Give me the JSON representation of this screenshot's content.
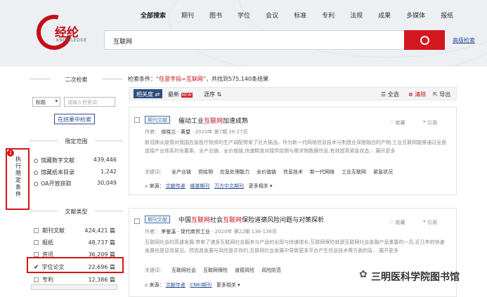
{
  "header": {
    "logo_text": "经纶",
    "logo_sub": "KNOWLEDGE",
    "nav": [
      "全部搜索",
      "期刊",
      "图书",
      "学位",
      "会议",
      "标准",
      "专利",
      "法规",
      "成果",
      "多媒体",
      "报纸"
    ],
    "search_value": "互联网",
    "advanced": "高级检索"
  },
  "sidebar": {
    "second_search_title": "二次检索",
    "field_select": "标题",
    "keyword_placeholder": "请输入检索词",
    "search_in_results": "在结果中检索",
    "scope_title": "限定范围",
    "scope": [
      {
        "label": "馆藏数字文献",
        "count": "439,446"
      },
      {
        "label": "馆藏纸本目录",
        "count": "1,242"
      },
      {
        "label": "OA开放获取",
        "count": "30,049"
      }
    ],
    "type_title": "文献类型",
    "types": [
      {
        "label": "期刊文献",
        "count": "424,421 篇"
      },
      {
        "label": "报纸",
        "count": "48,737 篇"
      },
      {
        "label": "资讯",
        "count": "36,209 篇"
      },
      {
        "label": "学位论文",
        "count": "22,696 篇"
      },
      {
        "label": "专利",
        "count": "12,386 篇"
      }
    ],
    "annotation_num": "1",
    "annotation_text": "执行限定条件"
  },
  "results": {
    "cond_prefix": "检索条件：",
    "cond_value": "“任意字段=互联网”",
    "cond_suffix": "，共找到575,140条结果",
    "sort": [
      "相关度 ⇄",
      "最新",
      "NEW",
      "涯序 ⇅"
    ],
    "actions": [
      "☰ 全选",
      "⊗ 清除",
      "⇱ 导出"
    ],
    "cards": [
      {
        "tag": "期刊文献",
        "title_pre": "催动工业",
        "title_hl": "互联网",
        "title_post": "加速成熟",
        "author_label": "作者：",
        "authors": "徐晓兰  · 黄望",
        "date": "· 2020年 第7期 26-27页",
        "abstract": "新冠肺炎疫情对我国应急医疗物资的生产调配带来了巨大挑战。作为新一代网络信息技术与制造业深度融合的产物,工业互联网能够通过全面连接产业体系的全要素、全产业链、全价值链,快速精准对接供给侧与需求侧数据信息,有效提高紧急状态... 展开更多",
        "kw_label": "关键词：",
        "keywords": [
          "全产业链",
          "供给侧",
          "应急处理能力",
          "全价值链",
          "信息技术",
          "新一代网络",
          "工业互联网",
          "紧急状况"
        ],
        "src_label": "来源：",
        "sources": [
          "文献传递",
          "维普期刊",
          "万方中文期刊",
          "更多相关 ▾"
        ],
        "fav": "♡ 收藏",
        "cite": "❞ 引用"
      },
      {
        "tag": "期刊文献",
        "title_pre": "中国",
        "title_hl": "互联网",
        "title_mid": "社会",
        "title_hl2": "互联网",
        "title_post": "保险道德风险问题与对策探析",
        "author_label": "作者：",
        "authors": "李鉴溪 · 现代商贸工业",
        "date": "· 2020年 第22期 136-136页",
        "abstract": "互联网社会的高速发展,带来了诸多互联网社会服务与产品的出现与快速增长,互联网保险就是互联网社会金融产品重要的一员,近几年的快速发展也是显而易见。然而其发展与风险是并存的,互联网社会发展中导致更多平台产生信息技术等方面的盲... 展开更多",
        "kw_label": "关键词：",
        "keywords": [
          "互联网社会",
          "互联网保险",
          "道德风险",
          "风险防范"
        ],
        "src_label": "来源：",
        "sources": [
          "文献传递",
          "CNKI期刊",
          "更多相关 ▾"
        ],
        "fav": "♡ 收藏",
        "cite": "❞ 引用"
      }
    ]
  },
  "watermark": "三明医科学院图书馆",
  "colors": {
    "accent": "#c40f18",
    "nav_blue": "#2b4f96"
  }
}
